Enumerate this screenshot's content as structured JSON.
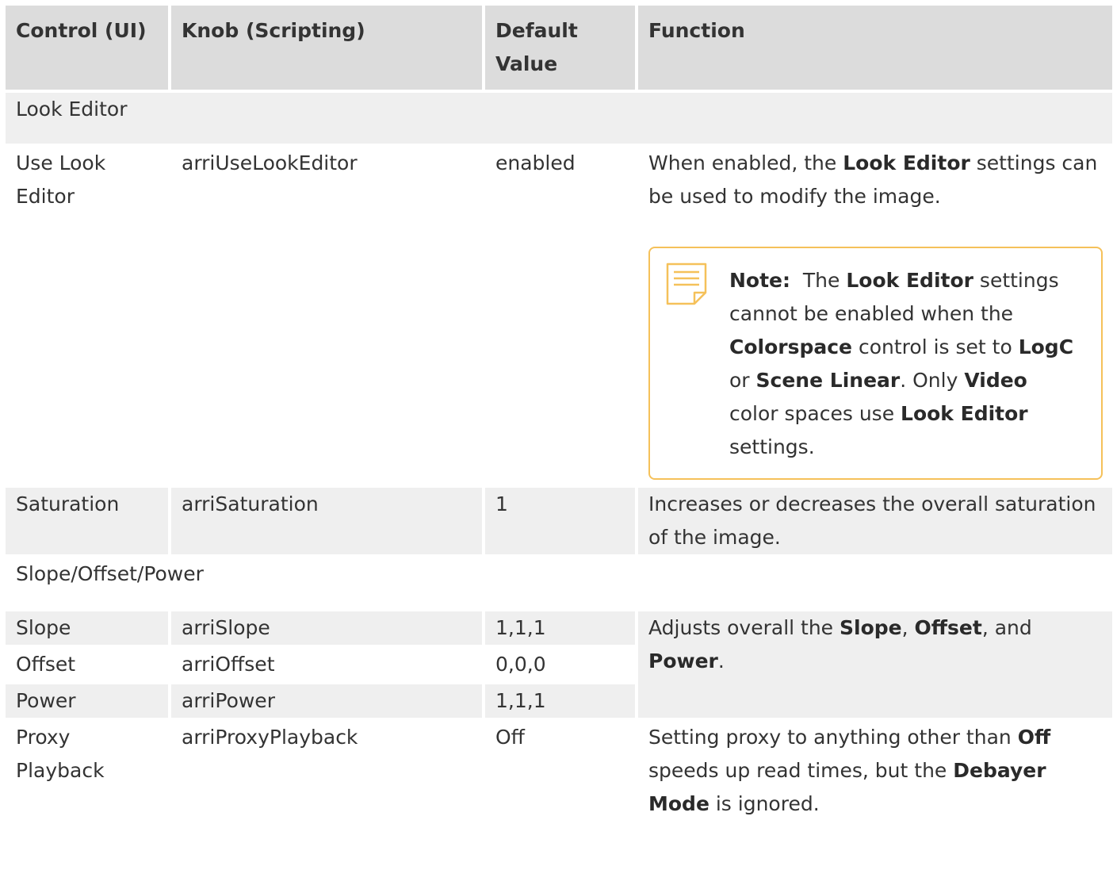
{
  "header": {
    "col1": "Control (UI)",
    "col2": "Knob (Scripting)",
    "col3": "Default Value",
    "col4": "Function"
  },
  "groups": {
    "look_editor": "Look Editor",
    "sop": "Slope/Offset/Power"
  },
  "rows": {
    "use_look_editor": {
      "control": "Use Look Editor",
      "knob": "arriUseLookEditor",
      "default": "enabled",
      "fn_1": "When enabled, the ",
      "fn_b1": "Look Editor",
      "fn_2": " settings can be used to modify the image."
    },
    "saturation": {
      "control": "Saturation",
      "knob": "arriSaturation",
      "default": "1",
      "fn": "Increases or decreases the overall saturation of the image."
    },
    "slope": {
      "control": "Slope",
      "knob": "arriSlope",
      "default": "1,1,1"
    },
    "offset": {
      "control": "Offset",
      "knob": "arriOffset",
      "default": "0,0,0"
    },
    "power": {
      "control": "Power",
      "knob": "arriPower",
      "default": "1,1,1"
    },
    "sop_function": {
      "t1": "Adjusts overall the ",
      "b1": "Slope",
      "t2": ", ",
      "b2": "Offset",
      "t3": ", and ",
      "b3": "Power",
      "t4": "."
    },
    "proxy": {
      "control": "Proxy Playback",
      "knob": "arriProxyPlayback",
      "default": "Off",
      "t1": "Setting proxy to anything other than ",
      "b1": "Off",
      "t2": " speeds up read times, but the ",
      "b2": "Debayer Mode",
      "t3": " is ignored."
    }
  },
  "note": {
    "icon": "note-icon",
    "label": "Note:",
    "t1": "  The ",
    "b1": "Look Editor",
    "t2": " settings cannot be enabled when the ",
    "b2": "Colorspace",
    "t3": " control is set to ",
    "b3": "LogC",
    "t4": " or ",
    "b4": "Scene Linear",
    "t5": ". Only ",
    "b5": "Video",
    "t6": " color spaces use ",
    "b6": "Look Editor",
    "t7": " settings."
  },
  "colors": {
    "header_bg": "#dcdcdc",
    "row_gray": "#efefef",
    "note_border": "#f5c15a"
  }
}
